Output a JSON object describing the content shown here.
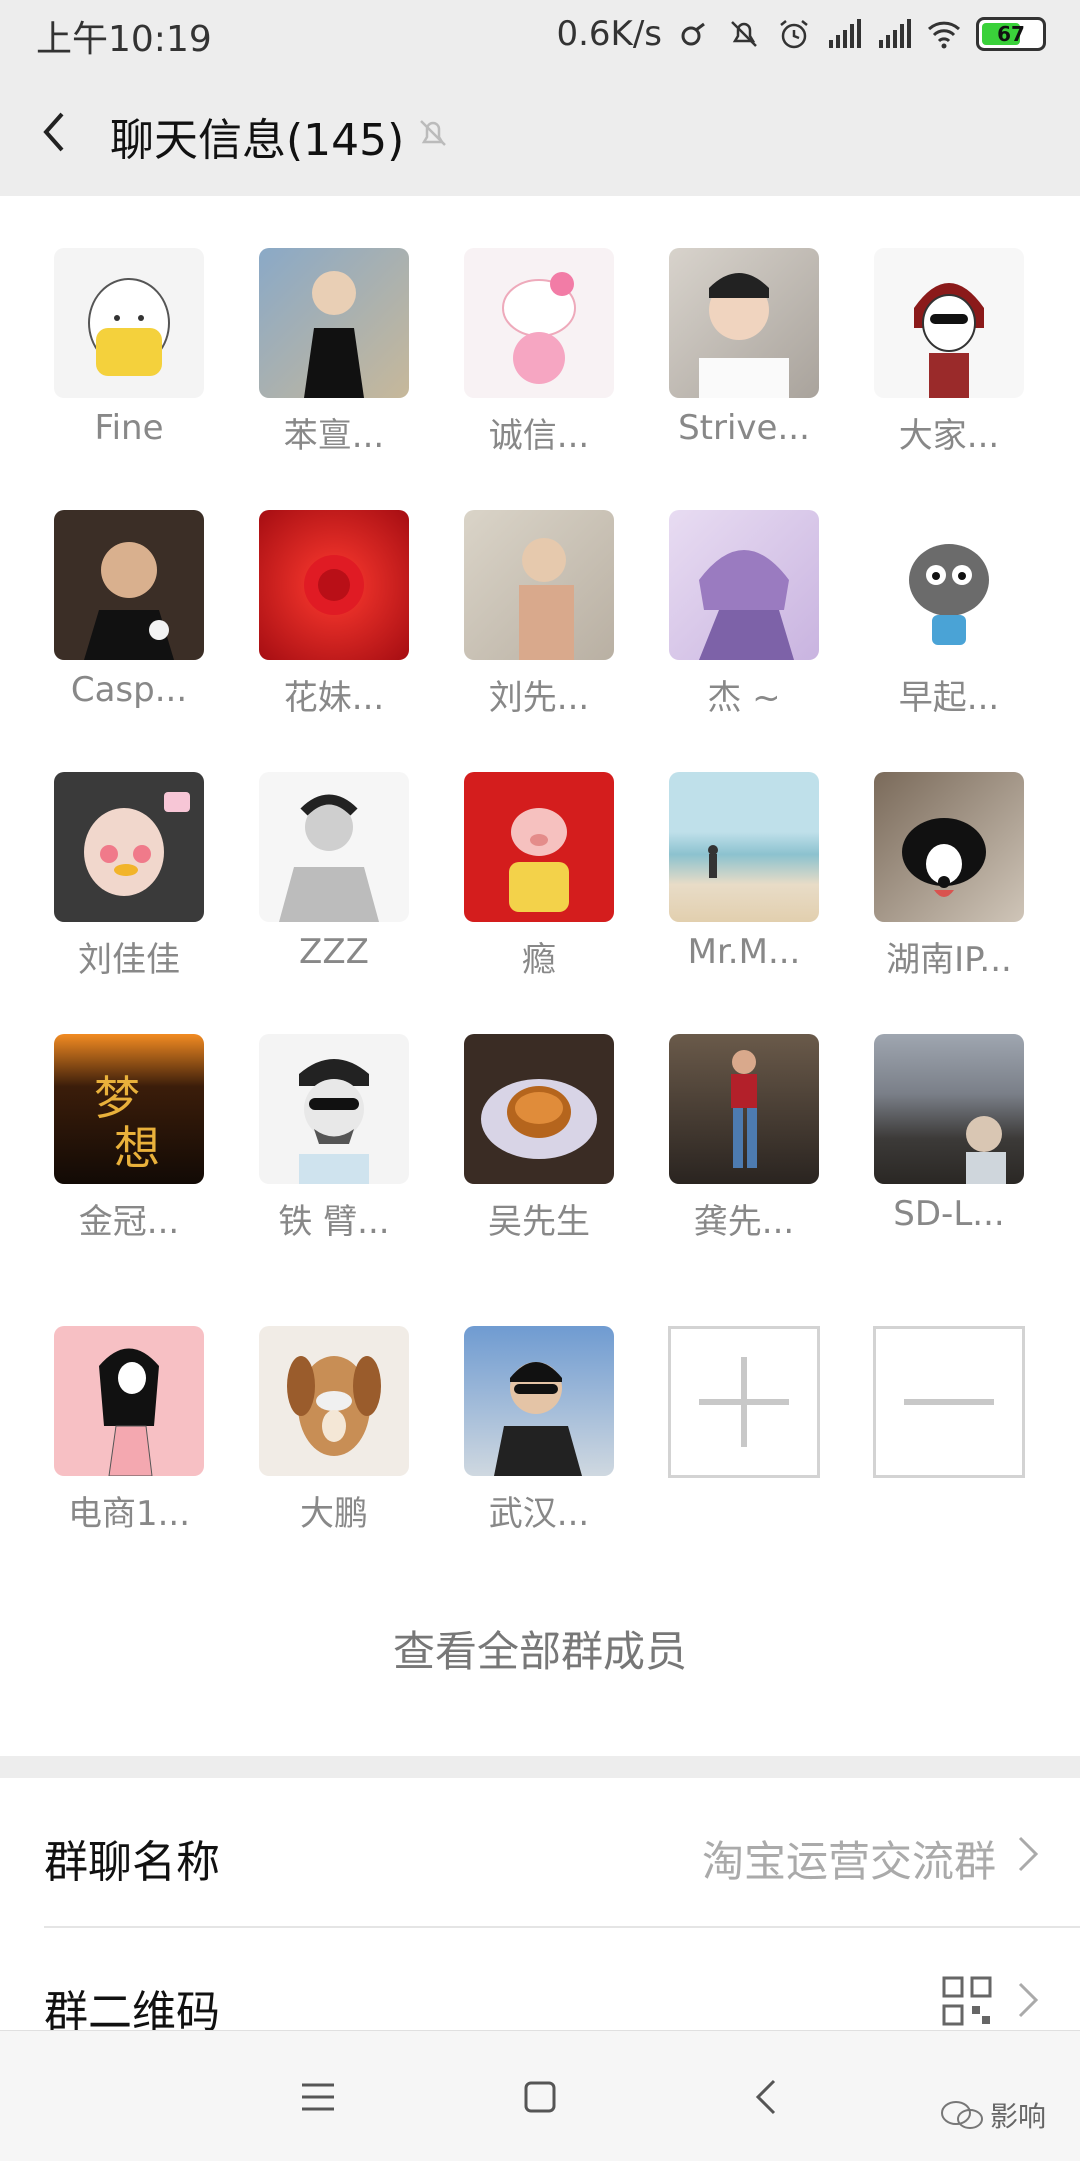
{
  "status": {
    "time": "上午10:19",
    "speed": "0.6K/s",
    "battery": "67"
  },
  "header": {
    "title": "聊天信息(145)",
    "back_icon": "back-arrow-icon",
    "mute_icon": "bell-muted-icon"
  },
  "members": [
    {
      "name": "Fine"
    },
    {
      "name": "苯亶..."
    },
    {
      "name": "诚信..."
    },
    {
      "name": "Strive..."
    },
    {
      "name": "大家..."
    },
    {
      "name": "Casp..."
    },
    {
      "name": "花妹..."
    },
    {
      "name": "刘先..."
    },
    {
      "name": "杰 ~"
    },
    {
      "name": "早起..."
    },
    {
      "name": "刘佳佳"
    },
    {
      "name": "ZZZ"
    },
    {
      "name": "瘾"
    },
    {
      "name": "Mr.M..."
    },
    {
      "name": "湖南IP..."
    },
    {
      "name": "金冠..."
    },
    {
      "name": "铁 臂..."
    },
    {
      "name": "吴先生"
    },
    {
      "name": "龚先..."
    },
    {
      "name": "SD-L..."
    },
    {
      "name": "电商1..."
    },
    {
      "name": "大鹏"
    },
    {
      "name": "武汉..."
    }
  ],
  "view_all": "查看全部群成员",
  "settings": {
    "group_name_label": "群聊名称",
    "group_name_value": "淘宝运营交流群",
    "qr_label": "群二维码"
  },
  "watermark": "影响",
  "colors": {
    "background": "#ededed",
    "accent_battery": "#3ad13a"
  }
}
